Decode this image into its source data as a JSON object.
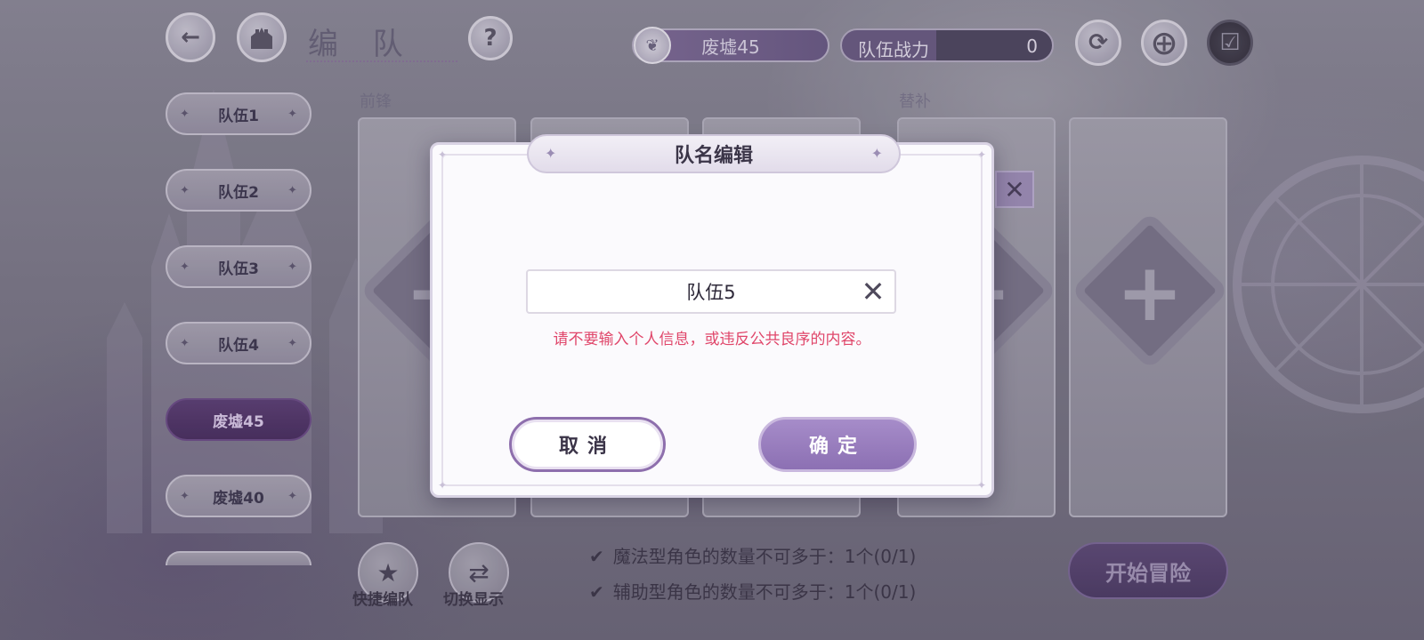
{
  "header": {
    "title": "编 队",
    "back_icon": "back-arrow-icon",
    "home_icon": "castle-home-icon",
    "help_icon": "question-icon",
    "stage_name": "废墟45",
    "stage_icon": "feather-icon",
    "power_label": "队伍战力",
    "power_value": "0",
    "refresh_icon": "refresh-icon",
    "copy_icon": "copy-plus-icon",
    "save_icon": "save-check-icon"
  },
  "teams": [
    {
      "label": "队伍1",
      "active": false
    },
    {
      "label": "队伍2",
      "active": false
    },
    {
      "label": "队伍3",
      "active": false
    },
    {
      "label": "队伍4",
      "active": false
    },
    {
      "label": "废墟45",
      "active": true
    },
    {
      "label": "废墟40",
      "active": false
    }
  ],
  "slots": {
    "front_label": "前锋",
    "sub_label": "替补",
    "add_icon": "plus-icon",
    "remove_icon": "close-icon"
  },
  "bottom": {
    "quick_team_label": "快捷编队",
    "quick_team_icon": "bookmark-star-icon",
    "switch_view_label": "切换显示",
    "switch_view_icon": "swap-arrows-icon",
    "rules": [
      "魔法型角色的数量不可多于：1个(0/1)",
      "辅助型角色的数量不可多于：1个(0/1)"
    ],
    "start_label": "开始冒险"
  },
  "dialog": {
    "title": "队名编辑",
    "input_value": "队伍5",
    "clear_icon": "close-icon",
    "warning": "请不要输入个人信息，或违反公共良序的内容。",
    "cancel_label": "取消",
    "confirm_label": "确定",
    "colors": {
      "warning": "#e0466a",
      "confirm_bg": "#9a7fbf",
      "accent": "#8e6fad"
    }
  }
}
